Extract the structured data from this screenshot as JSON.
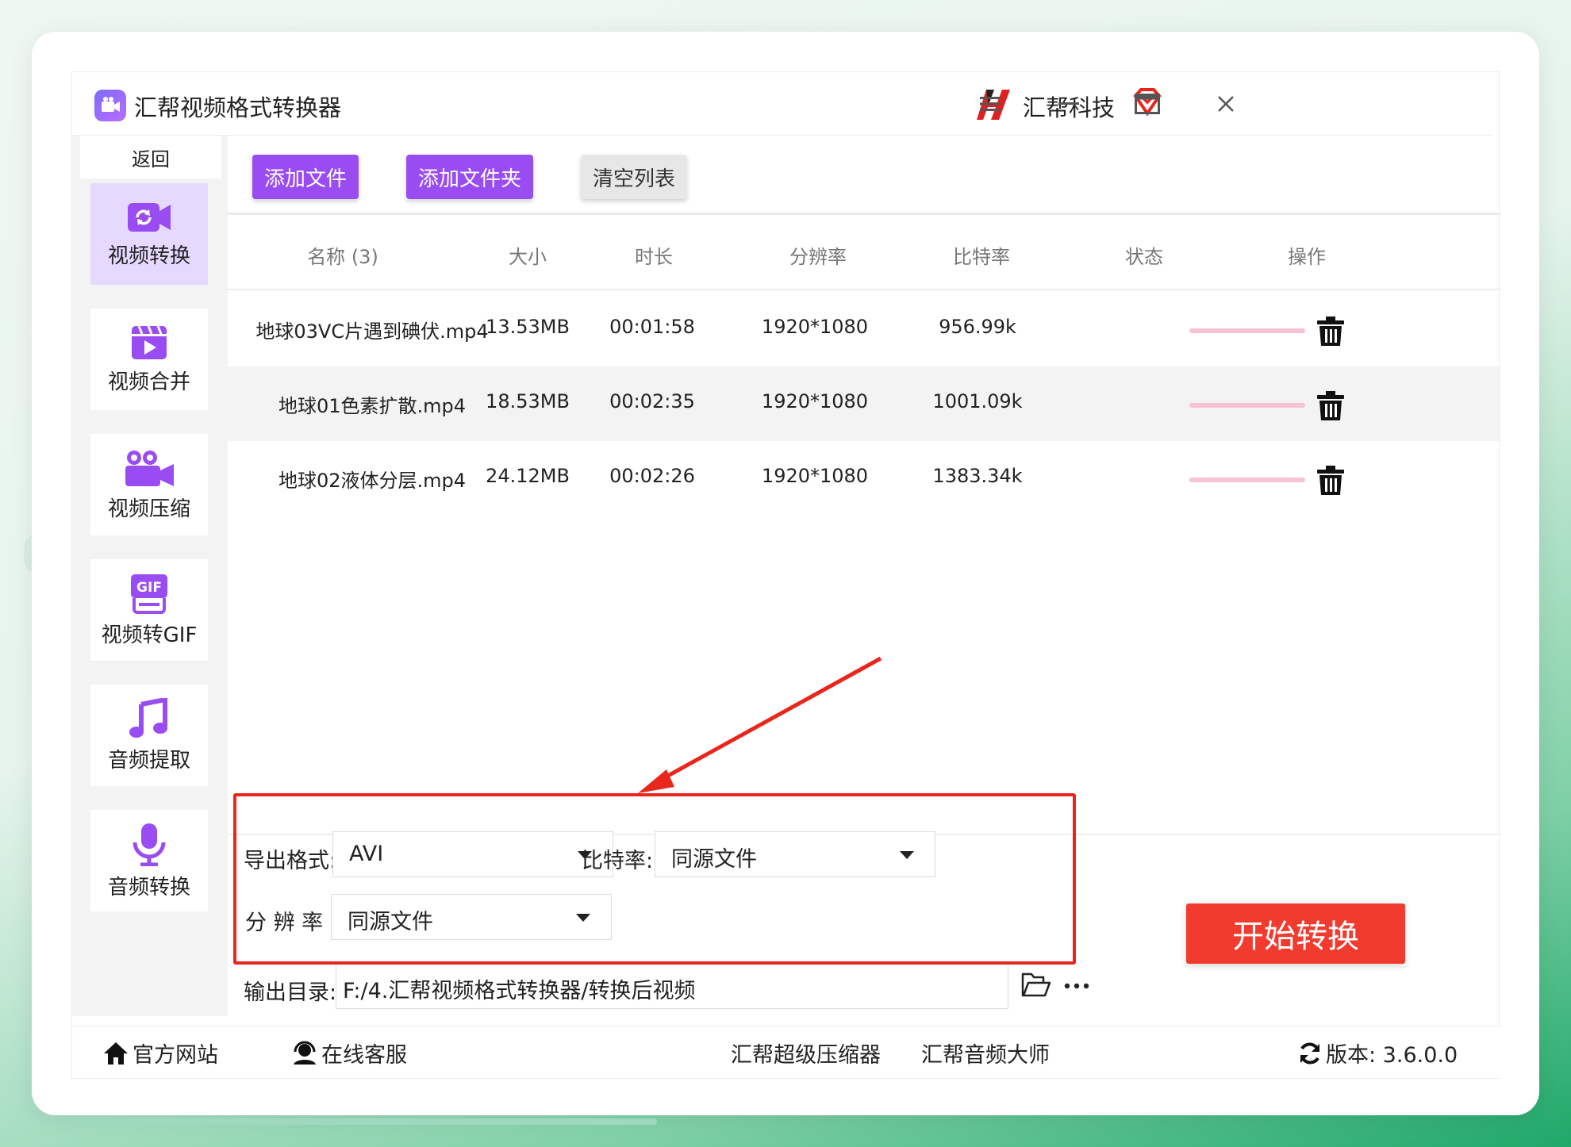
{
  "app": {
    "title": "汇帮视频格式转换器",
    "brand_name": "汇帮科技"
  },
  "sidebar": {
    "back_label": "返回",
    "items": [
      {
        "label": "视频转换",
        "icon": "video-convert-icon",
        "active": true
      },
      {
        "label": "视频合并",
        "icon": "video-merge-icon",
        "active": false
      },
      {
        "label": "视频压缩",
        "icon": "video-compress-icon",
        "active": false
      },
      {
        "label": "视频转GIF",
        "icon": "gif-icon",
        "active": false
      },
      {
        "label": "音频提取",
        "icon": "music-note-icon",
        "active": false
      },
      {
        "label": "音频转换",
        "icon": "microphone-icon",
        "active": false
      }
    ]
  },
  "toolbar": {
    "add_file": "添加文件",
    "add_folder": "添加文件夹",
    "clear_list": "清空列表"
  },
  "table": {
    "headers": {
      "name": "名称 (3)",
      "size": "大小",
      "duration": "时长",
      "resolution": "分辨率",
      "bitrate": "比特率",
      "status": "状态",
      "action": "操作"
    },
    "rows": [
      {
        "name": "地球03VC片遇到碘伏.mp4",
        "size": "13.53MB",
        "duration": "00:01:58",
        "resolution": "1920*1080",
        "bitrate": "956.99k"
      },
      {
        "name": "地球01色素扩散.mp4",
        "size": "18.53MB",
        "duration": "00:02:35",
        "resolution": "1920*1080",
        "bitrate": "1001.09k"
      },
      {
        "name": "地球02液体分层.mp4",
        "size": "24.12MB",
        "duration": "00:02:26",
        "resolution": "1920*1080",
        "bitrate": "1383.34k"
      }
    ]
  },
  "settings": {
    "format_label": "导出格式:",
    "format_value": "AVI",
    "bitrate_label": "比特率:",
    "bitrate_value": "同源文件",
    "resolution_label": "分 辨 率 :",
    "resolution_value": "同源文件",
    "output_label": "输出目录:",
    "output_value": "F:/4.汇帮视频格式转换器/转换后视频"
  },
  "start_button": "开始转换",
  "footer": {
    "website": "官方网站",
    "support": "在线客服",
    "compressor": "汇帮超级压缩器",
    "audio_master": "汇帮音频大师",
    "version": "版本:  3.6.0.0"
  },
  "colors": {
    "accent": "#9a4cf3",
    "start": "#f23b2f",
    "annotation": "#e8261c",
    "active_nav": "#e6d9ff"
  }
}
